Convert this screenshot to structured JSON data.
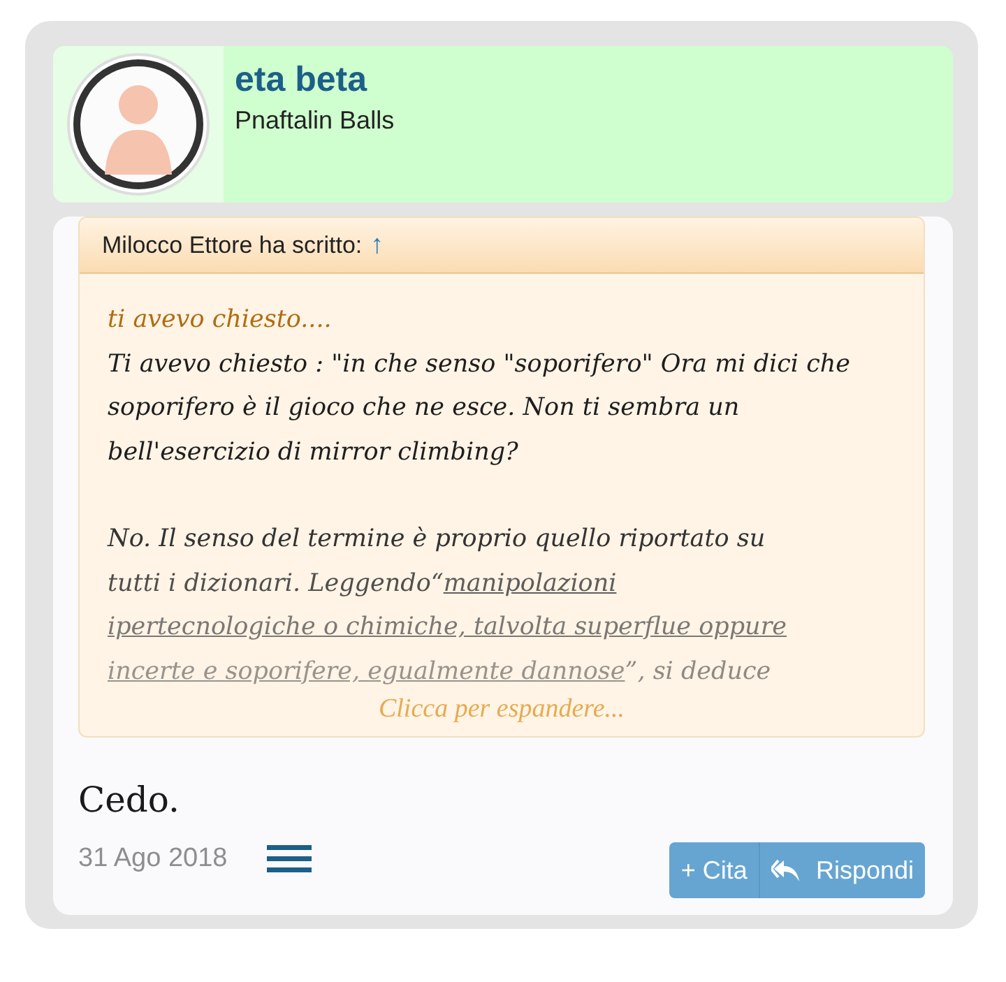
{
  "author": {
    "name": "eta beta",
    "title": "Pnaftalin Balls"
  },
  "quote": {
    "attribution": "Milocco Ettore ha scritto:",
    "jump": "↑",
    "paragraphs": [
      {
        "kind": "lead",
        "text": "ti avevo chiesto...."
      },
      {
        "kind": "body",
        "text": "Ti avevo chiesto : \"in che senso \"soporifero\" Ora mi dici che soporifero è il gioco che ne esce. Non ti sembra un bell'esercizio di mirror climbing?"
      },
      {
        "kind": "lines",
        "lines": [
          [
            {
              "kind": "text",
              "text": "No. Il senso del termine è proprio quello riportato su"
            }
          ],
          [
            {
              "kind": "text",
              "text": "tutti i dizionari. Leggendo“"
            },
            {
              "kind": "link",
              "text": "manipolazioni"
            }
          ],
          [
            {
              "kind": "link",
              "text": "ipertecnologiche o chimiche, talvolta superflue oppure"
            }
          ],
          [
            {
              "kind": "link",
              "text": "incerte e soporifere, egualmente dannose"
            },
            {
              "kind": "text",
              "text": "”, si deduce"
            }
          ]
        ]
      }
    ],
    "expand": "Clicca per espandere..."
  },
  "message": "Cedo.",
  "date": "31 Ago 2018",
  "buttons": [
    {
      "kind": "quote",
      "label": "+ Cita"
    },
    {
      "kind": "reply",
      "label": "Rispondi"
    }
  ]
}
